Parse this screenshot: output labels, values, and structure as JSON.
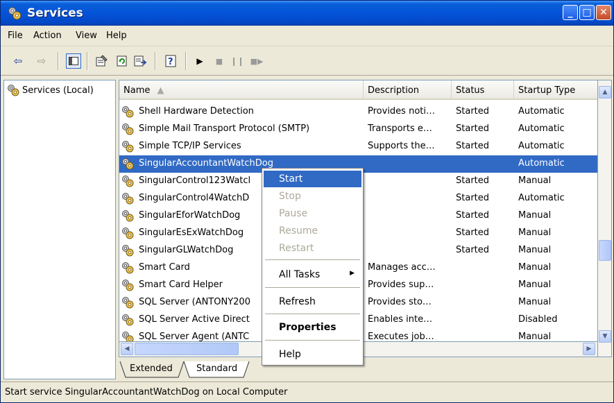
{
  "window": {
    "title": "Services"
  },
  "menubar": {
    "items": [
      "File",
      "Action",
      "View",
      "Help"
    ]
  },
  "toolbar": {
    "icons": [
      "back-arrow-icon",
      "forward-arrow-icon",
      "show-hide-tree-icon",
      "properties-icon",
      "refresh-icon",
      "export-list-icon",
      "help-icon",
      "play-icon",
      "stop-icon",
      "pause-icon",
      "restart-icon"
    ]
  },
  "tree": {
    "root_label": "Services (Local)"
  },
  "list": {
    "columns": [
      "Name",
      "Description",
      "Status",
      "Startup Type"
    ],
    "rows": [
      {
        "name": "Shell Hardware Detection",
        "description": "Provides noti…",
        "status": "Started",
        "startup": "Automatic"
      },
      {
        "name": "Simple Mail Transport Protocol (SMTP)",
        "description": "Transports e…",
        "status": "Started",
        "startup": "Automatic"
      },
      {
        "name": "Simple TCP/IP Services",
        "description": "Supports the…",
        "status": "Started",
        "startup": "Automatic"
      },
      {
        "name": "SingularAccountantWatchDog",
        "description": "",
        "status": "",
        "startup": "Automatic",
        "selected": true
      },
      {
        "name": "SingularControl123Watcl",
        "description": "",
        "status": "Started",
        "startup": "Manual"
      },
      {
        "name": "SingularControl4WatchD",
        "description": "",
        "status": "Started",
        "startup": "Automatic"
      },
      {
        "name": "SingularEforWatchDog",
        "description": "",
        "status": "Started",
        "startup": "Manual"
      },
      {
        "name": "SingularEsExWatchDog",
        "description": "",
        "status": "Started",
        "startup": "Manual"
      },
      {
        "name": "SingularGLWatchDog",
        "description": "",
        "status": "Started",
        "startup": "Manual"
      },
      {
        "name": "Smart Card",
        "description": "Manages acc…",
        "status": "",
        "startup": "Manual"
      },
      {
        "name": "Smart Card Helper",
        "description": "Provides sup…",
        "status": "",
        "startup": "Manual"
      },
      {
        "name": "SQL Server (ANTONY200",
        "description": "Provides sto…",
        "status": "",
        "startup": "Manual"
      },
      {
        "name": "SQL Server Active Direct",
        "description": "Enables inte…",
        "status": "",
        "startup": "Disabled"
      },
      {
        "name": "SQL Server Agent (ANTC",
        "description": "Executes job…",
        "status": "",
        "startup": "Manual"
      }
    ]
  },
  "tabs": [
    "Extended",
    "Standard"
  ],
  "context_menu": {
    "start": "Start",
    "stop": "Stop",
    "pause": "Pause",
    "resume": "Resume",
    "restart": "Restart",
    "all_tasks": "All Tasks",
    "refresh": "Refresh",
    "properties": "Properties",
    "help": "Help"
  },
  "statusbar": {
    "text": "Start service SingularAccountantWatchDog on Local Computer"
  },
  "colors": {
    "titlebar": "#0453d8",
    "selection": "#316ac5",
    "disabled_text": "#aca899"
  }
}
